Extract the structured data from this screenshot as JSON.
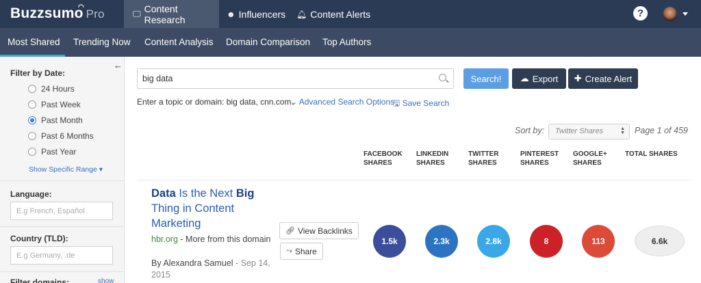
{
  "brand": {
    "name": "Buzzsumo",
    "tier": "Pro"
  },
  "topnav": {
    "content_research": "Content Research",
    "influencers": "Influencers",
    "content_alerts": "Content Alerts",
    "help": "?"
  },
  "subnav": {
    "tabs": [
      "Most Shared",
      "Trending Now",
      "Content Analysis",
      "Domain Comparison",
      "Top Authors"
    ],
    "active": "Most Shared"
  },
  "sidebar": {
    "date_filter_title": "Filter by Date:",
    "date_options": [
      {
        "label": "24 Hours",
        "checked": false
      },
      {
        "label": "Past Week",
        "checked": false
      },
      {
        "label": "Past Month",
        "checked": true
      },
      {
        "label": "Past 6 Months",
        "checked": false
      },
      {
        "label": "Past Year",
        "checked": false
      }
    ],
    "show_specific_range": "Show Specific Range ▾",
    "language_title": "Language:",
    "language_placeholder": "E.g French, Español",
    "country_title": "Country (TLD):",
    "country_placeholder": "E.g Germany, .de",
    "filter_domains_title": "Filter domains:",
    "filter_domains_link": "show"
  },
  "search": {
    "value": "big data",
    "button_label": "Search!",
    "export_label": "Export",
    "create_alert_label": "Create Alert",
    "hint": "Enter a topic or domain: big data, cnn.com.",
    "advanced_label": "Advanced Search Options",
    "save_label": "Save Search"
  },
  "sort": {
    "label": "Sort by:",
    "selected": "Twitter Shares",
    "page_info": "Page 1 of 459"
  },
  "columns": [
    "FACEBOOK SHARES",
    "LINKEDIN SHARES",
    "TWITTER SHARES",
    "PINTEREST SHARES",
    "GOOGLE+ SHARES",
    "TOTAL SHARES"
  ],
  "result": {
    "title_parts": [
      "Data",
      " Is the Next ",
      "Big",
      " Thing in Content Marketing"
    ],
    "domain": "hbr.org",
    "more_from": " - More from this domain",
    "author": "By Alexandra Samuel",
    "date": " - Sep 14, 2015",
    "view_backlinks": "View Backlinks",
    "share": "Share",
    "shares": {
      "facebook": "1.5k",
      "linkedin": "2.3k",
      "twitter": "2.8k",
      "pinterest": "8",
      "googleplus": "113",
      "total": "6.6k"
    }
  },
  "colors": {
    "topbar": "#2c3b55",
    "subbar": "#3c4a63",
    "facebook": "#3b4e9b",
    "linkedin": "#2c74c2",
    "twitter": "#3aa8e8",
    "pinterest": "#cc2127",
    "googleplus": "#dc4a38"
  },
  "icons": {
    "laptop": "laptop-icon",
    "users": "users-icon",
    "bell": "bell-icon",
    "help": "help-icon",
    "search": "search-icon",
    "cloud": "cloud-upload-icon",
    "plus": "plus-icon",
    "chevron": "chevron-down-icon",
    "save": "save-icon",
    "link": "link-icon",
    "share": "share-icon",
    "back": "arrow-left-icon"
  }
}
